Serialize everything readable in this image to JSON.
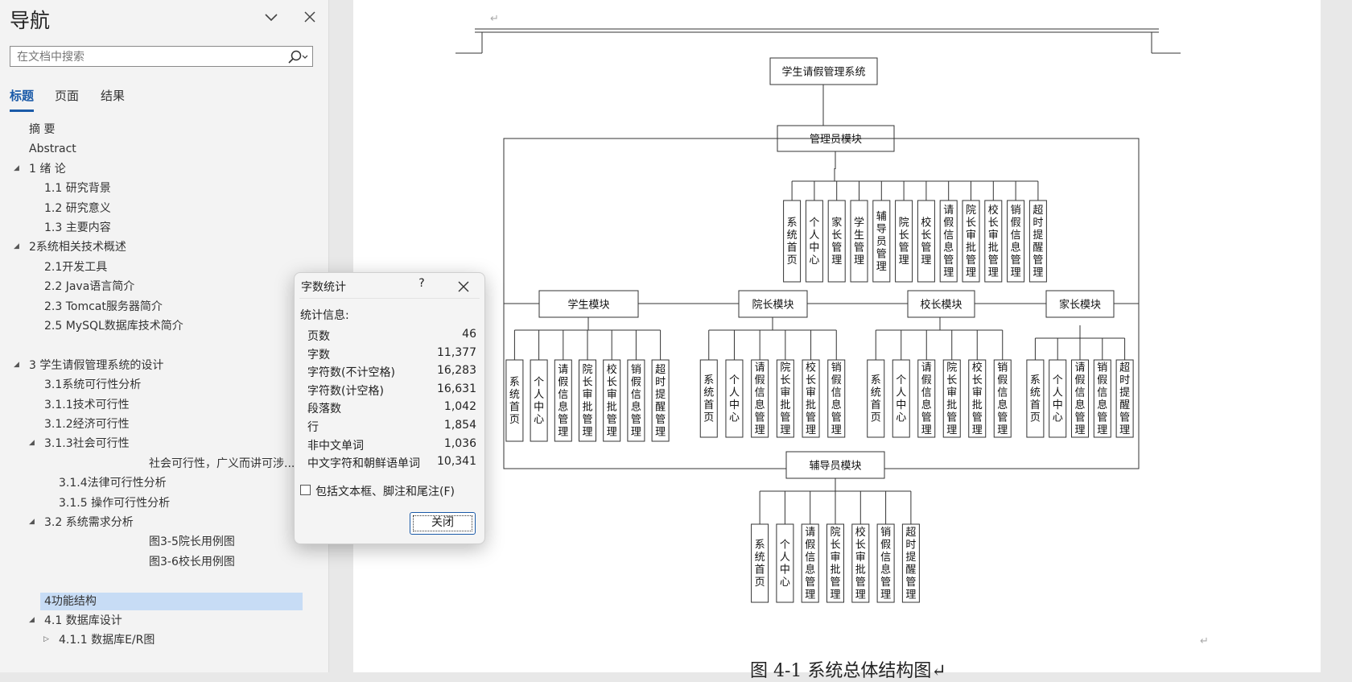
{
  "nav": {
    "title": "导航",
    "search_placeholder": "在文档中搜索",
    "tabs": [
      {
        "label": "标题",
        "active": true
      },
      {
        "label": "页面",
        "active": false
      },
      {
        "label": "结果",
        "active": false
      }
    ],
    "headings": [
      {
        "label": "摘  要",
        "level": 1,
        "arrow": ""
      },
      {
        "label": "Abstract",
        "level": 1,
        "arrow": ""
      },
      {
        "label": "1 绪  论",
        "level": 1,
        "arrow": "expanded"
      },
      {
        "label": "1.1 研究背景",
        "level": 2,
        "arrow": ""
      },
      {
        "label": "1.2 研究意义",
        "level": 2,
        "arrow": ""
      },
      {
        "label": "1.3 主要内容",
        "level": 2,
        "arrow": ""
      },
      {
        "label": "2系统相关技术概述",
        "level": 1,
        "arrow": "expanded"
      },
      {
        "label": "2.1开发工具",
        "level": 2,
        "arrow": ""
      },
      {
        "label": "2.2 Java语言简介",
        "level": 2,
        "arrow": ""
      },
      {
        "label": "2.3 Tomcat服务器简介",
        "level": 2,
        "arrow": ""
      },
      {
        "label": "2.5 MySQL数据库技术简介",
        "level": 2,
        "arrow": ""
      },
      {
        "label": "",
        "level": 1,
        "arrow": ""
      },
      {
        "label": "3 学生请假管理系统的设计",
        "level": 1,
        "arrow": "expanded"
      },
      {
        "label": "3.1系统可行性分析",
        "level": 2,
        "arrow": ""
      },
      {
        "label": "3.1.1技术可行性",
        "level": 2,
        "arrow": ""
      },
      {
        "label": "3.1.2经济可行性",
        "level": 2,
        "arrow": ""
      },
      {
        "label": "3.1.3社会可行性",
        "level": 2,
        "arrow": "expanded"
      },
      {
        "label": "社会可行性，广义而讲可涉...",
        "level": 5,
        "arrow": ""
      },
      {
        "label": "3.1.4法律可行性分析",
        "level": 3,
        "arrow": ""
      },
      {
        "label": "3.1.5 操作可行性分析",
        "level": 3,
        "arrow": ""
      },
      {
        "label": "3.2 系统需求分析",
        "level": 2,
        "arrow": "expanded"
      },
      {
        "label": "图3-5院长用例图",
        "level": 5,
        "arrow": ""
      },
      {
        "label": "图3-6校长用例图",
        "level": 5,
        "arrow": ""
      },
      {
        "label": "",
        "level": 1,
        "arrow": ""
      },
      {
        "label": "4功能结构",
        "level": 2,
        "arrow": "",
        "selected": true
      },
      {
        "label": "4.1 数据库设计",
        "level": 2,
        "arrow": "expanded"
      },
      {
        "label": "4.1.1 数据库E/R图",
        "level": 3,
        "arrow": "collapsed"
      }
    ]
  },
  "dialog": {
    "title": "字数统计",
    "help": "?",
    "section": "统计信息:",
    "stats": [
      {
        "label": "页数",
        "value": "46"
      },
      {
        "label": "字数",
        "value": "11,377"
      },
      {
        "label": "字符数(不计空格)",
        "value": "16,283"
      },
      {
        "label": "字符数(计空格)",
        "value": "16,631"
      },
      {
        "label": "段落数",
        "value": "1,042"
      },
      {
        "label": "行",
        "value": "1,854"
      },
      {
        "label": "非中文单词",
        "value": "1,036"
      },
      {
        "label": "中文字符和朝鲜语单词",
        "value": "10,341"
      }
    ],
    "checkbox_label": "包括文本框、脚注和尾注(F)",
    "checkbox_checked": false,
    "close_button": "关闭"
  },
  "document": {
    "para_mark": "↵",
    "caption": "图 4-1  系统总体结构图↵",
    "diagram": {
      "root": "学生请假管理系统",
      "admin": {
        "label": "管理员模块",
        "items": [
          "系统首页",
          "个人中心",
          "家长管理",
          "学生管理",
          "辅导员管理",
          "院长管理",
          "校长管理",
          "请假信息管理",
          "院长审批管理",
          "校长审批管理",
          "销假信息管理",
          "超时提醒管理"
        ]
      },
      "student": {
        "label": "学生模块",
        "items": [
          "系统首页",
          "个人中心",
          "请假信息管理",
          "院长审批管理",
          "校长审批管理",
          "销假信息管理",
          "超时提醒管理"
        ]
      },
      "dean": {
        "label": "院长模块",
        "items": [
          "系统首页",
          "个人中心",
          "请假信息管理",
          "院长审批管理",
          "校长审批管理",
          "销假信息管理"
        ]
      },
      "principal": {
        "label": "校长模块",
        "items": [
          "系统首页",
          "个人中心",
          "请假信息管理",
          "院长审批管理",
          "校长审批管理",
          "销假信息管理"
        ]
      },
      "parent": {
        "label": "家长模块",
        "items": [
          "系统首页",
          "个人中心",
          "请假信息管理",
          "销假信息管理",
          "超时提醒管理"
        ]
      },
      "counselor": {
        "label": "辅导员模块",
        "items": [
          "系统首页",
          "个人中心",
          "请假信息管理",
          "院长审批管理",
          "校长审批管理",
          "销假信息管理",
          "超时提醒管理"
        ]
      }
    }
  }
}
